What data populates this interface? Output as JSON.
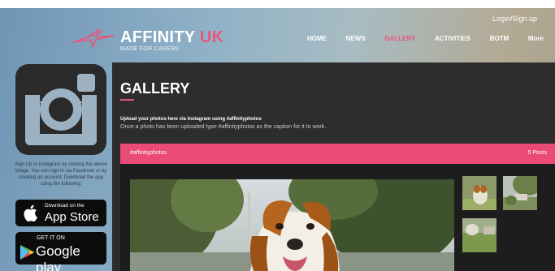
{
  "header": {
    "login_label": "Login/Sign up",
    "brand_name": "AFFINITY",
    "brand_suffix": "UK",
    "tagline": "MADE FOR CARERS"
  },
  "nav": {
    "items": [
      {
        "label": "HOME",
        "active": false
      },
      {
        "label": "NEWS",
        "active": false
      },
      {
        "label": "GALLERY",
        "active": true
      },
      {
        "label": "ACTIVITIES",
        "active": false
      },
      {
        "label": "BOTM",
        "active": false
      },
      {
        "label": "More",
        "active": false
      }
    ]
  },
  "sidebar": {
    "signup_text": "Sign Up to Instagram by clicking the above image. You can sign in via Facebook or by creating an account. Download the app using the following:",
    "app_store": {
      "small": "Download on the",
      "big": "App Store"
    },
    "google_play": {
      "small": "GET IT ON",
      "big": "Google play"
    }
  },
  "gallery": {
    "title": "GALLERY",
    "upload_text": "Upload your photos here via Instagram using #affinityphotos",
    "caption_text": "Once a photo has been uploaded type #affinityphotos as the caption for it to work.",
    "hashtag": "#affinityphotos",
    "post_count": "5 Posts"
  },
  "colors": {
    "accent": "#e8567e",
    "hashbar": "#e94b76",
    "panel": "#2d2d2d"
  }
}
